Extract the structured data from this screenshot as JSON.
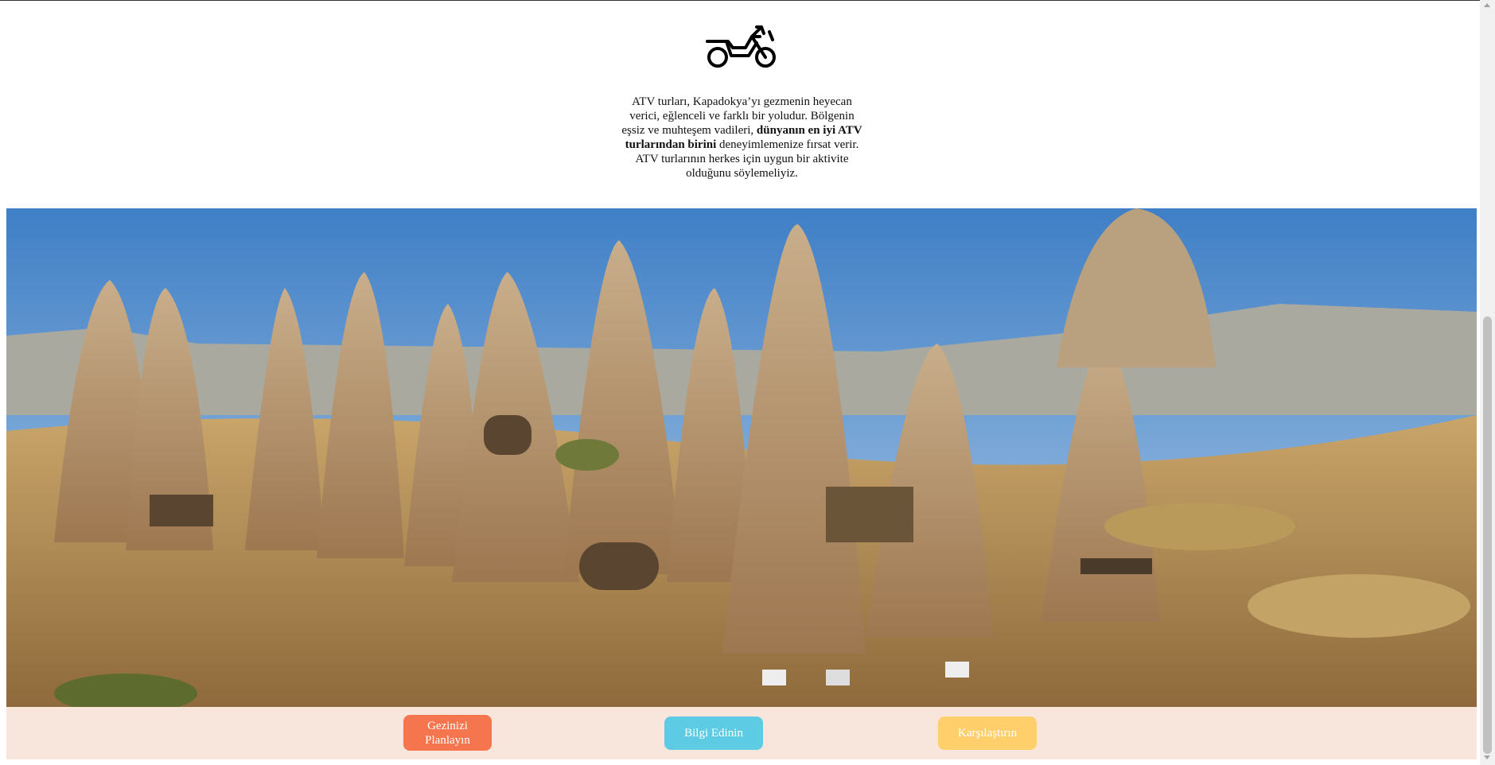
{
  "icon": {
    "name": "motorcycle-icon"
  },
  "intro": {
    "text_before": "ATV turları, Kapadokya’yı gezmenin heyecan verici, eğlenceli ve farklı bir yoludur. Bölgenin eşsiz ve muhteşem vadileri,",
    "text_bold": "dünyanın en iyi ATV turlarından birini",
    "text_after": "deneyimlemenize fırsat verir. ATV turlarının herkes için uygun bir aktivite olduğunu söylemeliyiz."
  },
  "hero": {
    "image_name": "cappadocia-fairy-chimneys-image"
  },
  "buttons": {
    "plan_label": "Gezinizi Planlayın",
    "info_label": "Bilgi Edinin",
    "compare_label": "Karşılaştırın"
  },
  "colors": {
    "plan_button": "#f5754f",
    "info_button": "#5ccbe3",
    "compare_button": "#ffcf6b",
    "cta_bar": "#f8e6dd"
  }
}
